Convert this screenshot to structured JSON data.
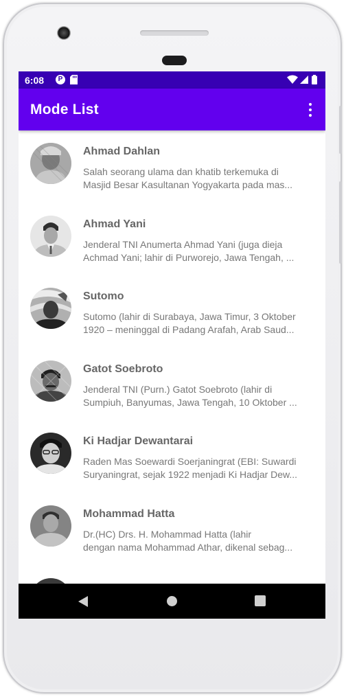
{
  "status_bar": {
    "time": "6:08",
    "background": "#3700b3",
    "left_icons": [
      "p-notification-icon",
      "sd-card-icon"
    ],
    "right_icons": [
      "wifi-icon",
      "signal-icon",
      "battery-icon"
    ]
  },
  "app_bar": {
    "title": "Mode List",
    "background": "#6200ee",
    "menu_icon": "more-vert-icon"
  },
  "list": {
    "items": [
      {
        "name": "Ahmad Dahlan",
        "desc_line1": "Salah seorang ulama dan khatib terkemuka di",
        "desc_line2": "Masjid Besar Kasultanan Yogyakarta pada mas..."
      },
      {
        "name": "Ahmad Yani",
        "desc_line1": "Jenderal TNI Anumerta Ahmad Yani (juga dieja",
        "desc_line2": "Achmad Yani; lahir di Purworejo, Jawa Tengah, ..."
      },
      {
        "name": "Sutomo",
        "desc_line1": "Sutomo (lahir di Surabaya, Jawa Timur, 3 Oktober",
        "desc_line2": "1920 – meninggal di Padang Arafah, Arab Saud..."
      },
      {
        "name": "Gatot Soebroto",
        "desc_line1": "Jenderal TNI (Purn.) Gatot Soebroto (lahir di",
        "desc_line2": "Sumpiuh, Banyumas, Jawa Tengah, 10 Oktober ..."
      },
      {
        "name": "Ki Hadjar Dewantarai",
        "desc_line1": "Raden Mas Soewardi Soerjaningrat (EBI: Suwardi",
        "desc_line2": "Suryaningrat, sejak 1922 menjadi Ki Hadjar Dew..."
      },
      {
        "name": "Mohammad Hatta",
        "desc_line1": "Dr.(HC) Drs. H. Mohammad Hatta (lahir",
        "desc_line2": "dengan nama Mohammad Athar, dikenal sebag..."
      }
    ]
  },
  "nav_bar": {
    "buttons": [
      "back-icon",
      "home-icon",
      "recents-icon"
    ]
  }
}
